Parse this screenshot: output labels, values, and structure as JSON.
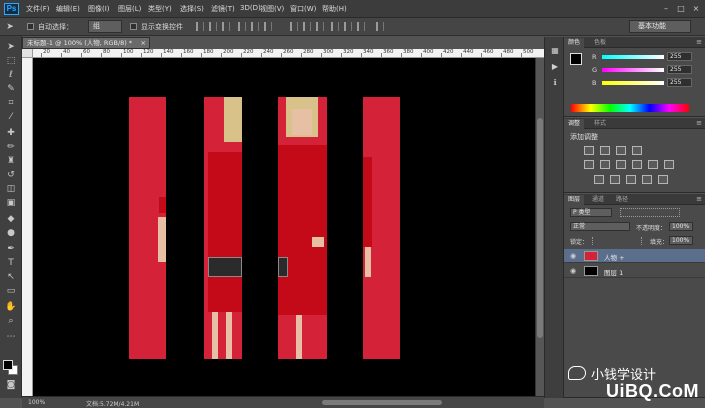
{
  "app": {
    "logo": "Ps"
  },
  "menu": [
    "文件(F)",
    "编辑(E)",
    "图像(I)",
    "图层(L)",
    "类型(Y)",
    "选择(S)",
    "滤镜(T)",
    "3D(D)",
    "视图(V)",
    "窗口(W)",
    "帮助(H)"
  ],
  "window_controls": [
    "–",
    "□",
    "×"
  ],
  "options": {
    "auto_select_label": "自动选择：",
    "auto_select_value": "组",
    "show_transform_label": "显示变换控件",
    "workspace": "基本功能"
  },
  "document": {
    "tab_title": "未标题-1 @ 100% (人物, RGB/8) *",
    "tab_close": "×",
    "ruler_ticks": [
      "20",
      "40",
      "60",
      "80",
      "100",
      "120",
      "140",
      "160",
      "180",
      "200",
      "220",
      "240",
      "260",
      "280",
      "300",
      "320",
      "340",
      "360",
      "380",
      "400",
      "420",
      "440",
      "460",
      "480",
      "500"
    ],
    "zoom": "100%",
    "doc_info": "文档:5.72M/4.21M"
  },
  "color_panel": {
    "tabs": [
      "颜色",
      "色板"
    ],
    "channels": [
      {
        "label": "R",
        "value": "255"
      },
      {
        "label": "G",
        "value": "255"
      },
      {
        "label": "B",
        "value": "255"
      }
    ]
  },
  "adjust_panel": {
    "tabs": [
      "调整",
      "样式"
    ],
    "heading": "添加调整"
  },
  "layers_panel": {
    "tabs": [
      "图层",
      "通道",
      "路径"
    ],
    "filter": "P 类型",
    "blend_mode": "正常",
    "opacity_label": "不透明度：",
    "opacity_value": "100%",
    "lock_label": "锁定：",
    "fill_label": "填充：",
    "fill_value": "100%",
    "layers": [
      {
        "name": "人物 +",
        "selected": true
      },
      {
        "name": "图层 1",
        "selected": false
      }
    ]
  },
  "watermark": {
    "text": "小钱学设计",
    "brand": "UiBQ.CoM"
  },
  "colors": {
    "accent": "#31a8ff",
    "canvas_bg": "#000000",
    "photo_red": "#d42238"
  }
}
